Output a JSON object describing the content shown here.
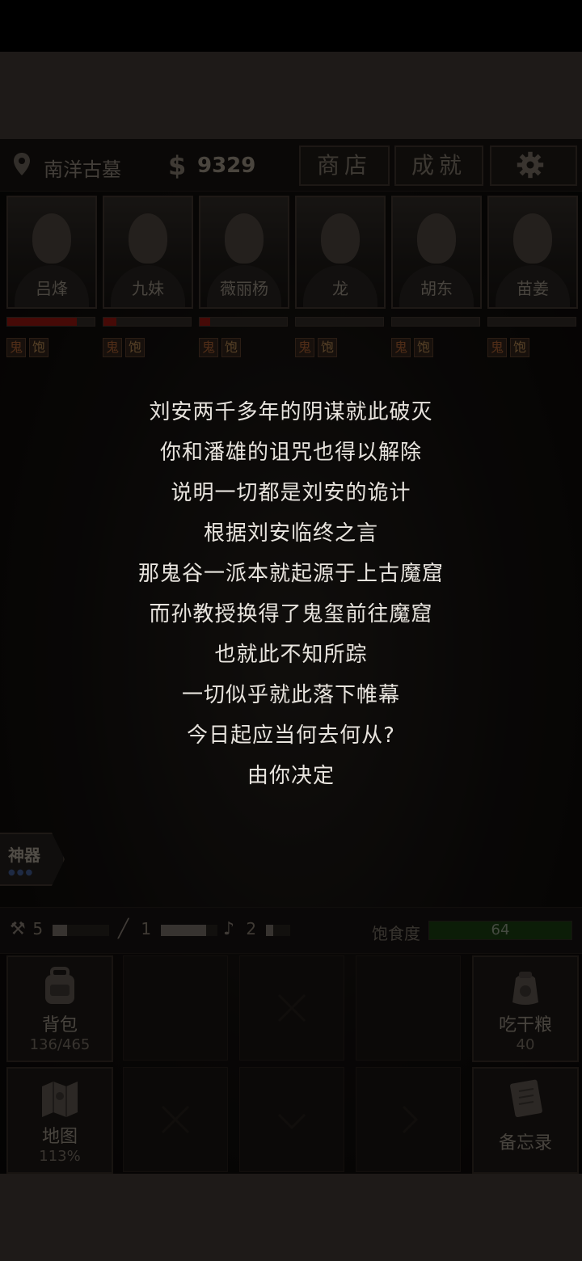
{
  "location": {
    "name": "南洋古墓"
  },
  "money": {
    "symbol": "$",
    "amount": "9329"
  },
  "top_buttons": {
    "shop": "商店",
    "achievements": "成就"
  },
  "party": [
    {
      "name": "吕烽",
      "hp": 0.8
    },
    {
      "name": "九妹",
      "hp": 0.15
    },
    {
      "name": "薇丽杨",
      "hp": 0.12
    },
    {
      "name": "龙",
      "hp": 0
    },
    {
      "name": "胡东",
      "hp": 0
    },
    {
      "name": "苗姜",
      "hp": 0
    }
  ],
  "status_tags": {
    "ghost": "鬼",
    "full": "饱"
  },
  "story_lines": [
    "刘安两千多年的阴谋就此破灭",
    "你和潘雄的诅咒也得以解除",
    "说明一切都是刘安的诡计",
    "根据刘安临终之言",
    "那鬼谷一派本就起源于上古魔窟",
    "而孙教授换得了鬼玺前往魔窟",
    "也就此不知所踪",
    "一切似乎就此落下帷幕",
    "今日起应当何去何从?",
    "由你决定"
  ],
  "relic": {
    "label": "神器"
  },
  "resources": {
    "shovel": {
      "count": "5",
      "level": 0.25
    },
    "rope": {
      "count": "1",
      "level": 0.8
    },
    "pick": {
      "count": "2",
      "level": 0.3
    }
  },
  "satiety": {
    "label": "饱食度",
    "value": "64",
    "level": 1.0
  },
  "actions": {
    "backpack": {
      "label": "背包",
      "value": "136/465"
    },
    "eat": {
      "label": "吃干粮",
      "value": "40"
    },
    "map": {
      "label": "地图",
      "value": "113%"
    },
    "memo": {
      "label": "备忘录"
    }
  },
  "colors": {
    "hp": "#b01a12",
    "satiety": "#1f4a16",
    "accent": "#c8703a"
  }
}
